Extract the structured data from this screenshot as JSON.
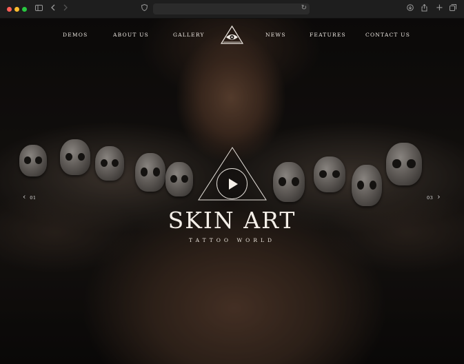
{
  "browser": {
    "icons": [
      "sidebar-icon",
      "back-icon",
      "forward-icon",
      "shield-icon",
      "reload-icon",
      "download-icon",
      "share-icon",
      "new-tab-icon",
      "tabs-overview-icon"
    ]
  },
  "nav": {
    "items": [
      "DEMOS",
      "ABOUT US",
      "GALLERY",
      "NEWS",
      "FEATURES",
      "CONTACT US"
    ]
  },
  "hero": {
    "title": "SKIN ART",
    "subtitle": "TATTOO WORLD"
  },
  "slider": {
    "prev_number": "01",
    "next_number": "03",
    "prev_arrow": "‹",
    "next_arrow": "›"
  },
  "colors": {
    "text": "#f1ece6",
    "chrome": "#1e1e1e"
  }
}
